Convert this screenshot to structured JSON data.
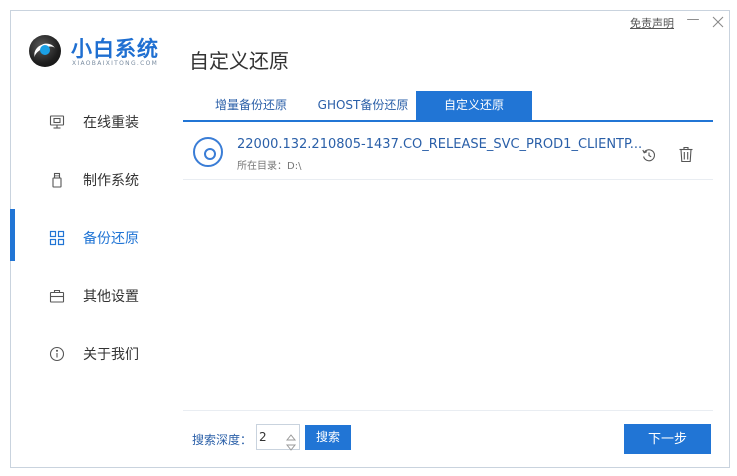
{
  "app": {
    "logo_title": "小白系统",
    "logo_subtitle": "XIAOBAIXITONG.COM",
    "disclaimer": "免责声明"
  },
  "sidebar": {
    "items": [
      {
        "label": "在线重装",
        "icon": "monitor-icon",
        "active": false
      },
      {
        "label": "制作系统",
        "icon": "usb-drive-icon",
        "active": false
      },
      {
        "label": "备份还原",
        "icon": "grid-icon",
        "active": true
      },
      {
        "label": "其他设置",
        "icon": "briefcase-icon",
        "active": false
      },
      {
        "label": "关于我们",
        "icon": "info-icon",
        "active": false
      }
    ]
  },
  "main": {
    "page_title": "自定义还原",
    "tabs": [
      {
        "label": "增量备份还原",
        "active": false
      },
      {
        "label": "GHOST备份还原",
        "active": false
      },
      {
        "label": "自定义还原",
        "active": true
      }
    ],
    "list": [
      {
        "name": "22000.132.210805-1437.CO_RELEASE_SVC_PROD1_CLIENTP...",
        "path": "所在目录：D:\\",
        "icon": "disc-icon",
        "actions": [
          "restore-icon",
          "trash-icon"
        ]
      }
    ]
  },
  "footer": {
    "depth_label": "搜索深度：",
    "depth_value": "2",
    "search_label": "搜索",
    "next_label": "下一步"
  },
  "colors": {
    "accent": "#2175d5",
    "link_text": "#2a5fa8",
    "border": "#c9d3de"
  }
}
